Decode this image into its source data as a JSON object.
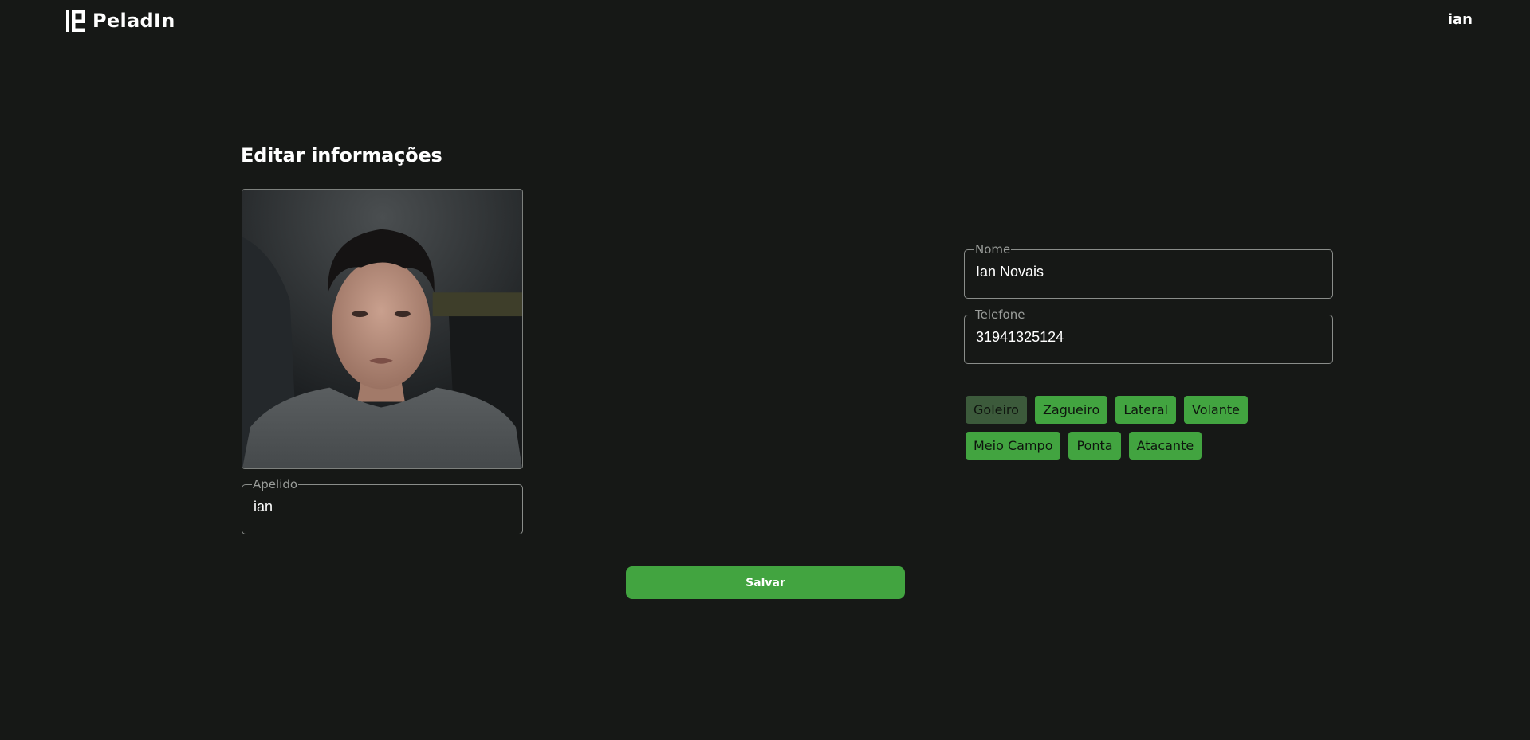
{
  "header": {
    "brand": "PeladIn",
    "user": "ian"
  },
  "page": {
    "title": "Editar informações"
  },
  "profile": {
    "photo_icon": "user-photo",
    "apelido": {
      "label": "Apelido",
      "value": "ian"
    }
  },
  "form": {
    "nome": {
      "label": "Nome",
      "value": "Ian Novais"
    },
    "telefone": {
      "label": "Telefone",
      "value": "31941325124"
    }
  },
  "positions": {
    "row1": [
      "Goleiro",
      "Zagueiro",
      "Lateral",
      "Volante"
    ],
    "row2": [
      "Meio Campo",
      "Ponta",
      "Atacante"
    ],
    "selected": "Goleiro"
  },
  "actions": {
    "save_label": "Salvar"
  },
  "colors": {
    "background": "#161816",
    "accent": "#42a440",
    "chip_selected": "#3c5a3b",
    "field_border": "#8a8d8a"
  }
}
